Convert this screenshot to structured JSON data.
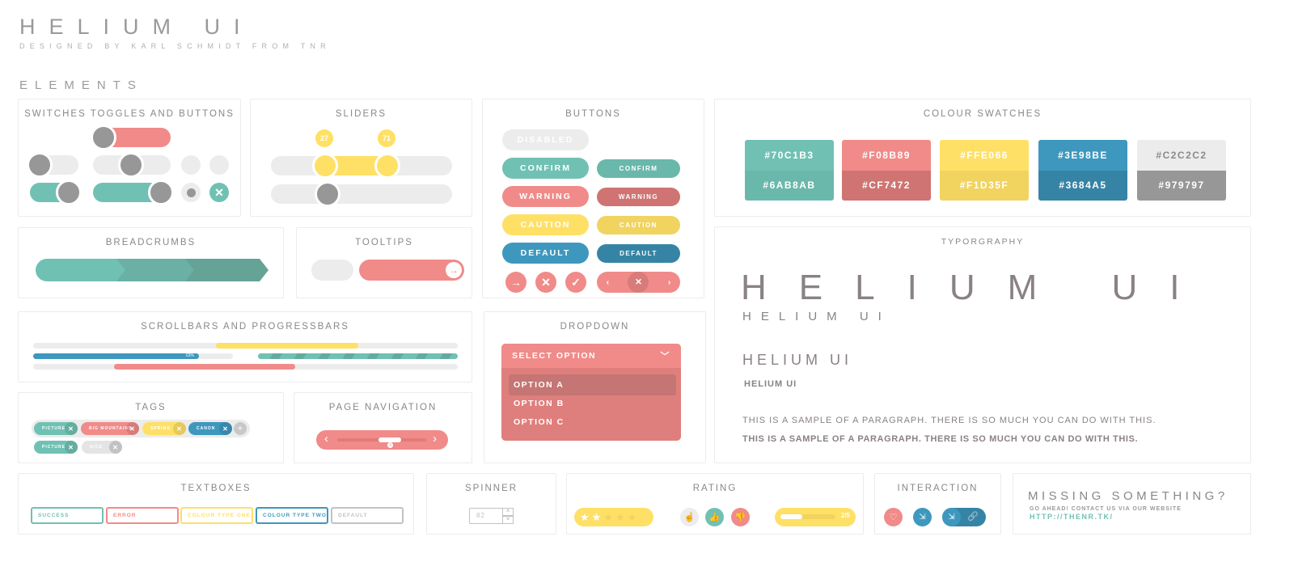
{
  "header": {
    "title": "HELIUM UI",
    "subtitle": "DESIGNED BY KARL SCHMIDT FROM TNR",
    "section": "ELEMENTS"
  },
  "cards": {
    "switches": "SWITCHES TOGGLES AND BUTTONS",
    "sliders": "SLIDERS",
    "buttons": "BUTTONS",
    "swatches": "COLOUR SWATCHES",
    "breadcrumbs": "BREADCRUMBS",
    "tooltips": "TOOLTIPS",
    "typography": "TYPORGRAPHY",
    "scrollbars": "SCROLLBARS AND PROGRESSBARS",
    "dropdown": "DROPDOWN",
    "tags": "TAGS",
    "page_navigation": "PAGE NAVIGATION",
    "textboxes": "TEXTBOXES",
    "spinner": "SPINNER",
    "rating": "RATING",
    "interaction": "INTERACTION"
  },
  "switches": {
    "toggle_states": [
      "off",
      "off",
      "middle",
      "on",
      "on"
    ],
    "radio_states": [
      "empty",
      "empty",
      "selected",
      "checked"
    ]
  },
  "sliders": {
    "range": {
      "low": 27,
      "high": 71,
      "low_label": "27",
      "high_label": "71"
    },
    "single": {
      "value": 31
    }
  },
  "buttons": {
    "disabled": "DISABLED",
    "confirm": "CONFIRM",
    "warning": "WARNING",
    "caution": "CAUTION",
    "default": "DEFAULT",
    "icons": [
      "arrow-right",
      "close",
      "check"
    ],
    "group_icons": [
      "chevron-left",
      "close",
      "chevron-right"
    ]
  },
  "swatches": [
    {
      "name": "teal",
      "light": "#70C1B3",
      "dark": "#6AB8AB"
    },
    {
      "name": "red",
      "light": "#F08B89",
      "dark": "#CF7472"
    },
    {
      "name": "yellow",
      "light": "#FFE066",
      "dark": "#F1D35F"
    },
    {
      "name": "blue",
      "light": "#3E98BE",
      "dark": "#3684A5"
    },
    {
      "name": "gray",
      "light": "#C2C2C2",
      "dark": "#979797"
    }
  ],
  "scrollbars": {
    "progress_label": "63%",
    "progress_value": 0.63
  },
  "dropdown": {
    "placeholder": "SELECT OPTION",
    "options": [
      "OPTION A",
      "OPTION B",
      "OPTION C"
    ],
    "highlighted": "OPTION A"
  },
  "tags": {
    "row1": [
      "PICTURE",
      "BIG MOUNTAINS",
      "SPRING",
      "CANON"
    ],
    "row2": [
      "PICTURE",
      "NICE"
    ]
  },
  "page_navigation": {
    "current_page": "3"
  },
  "typography": {
    "h1": "HELIUM UI",
    "h2": "HELIUM UI",
    "h3": "HELIUM UI",
    "h4": "HELIUM UI",
    "p1": "THIS IS A SAMPLE OF A PARAGRAPH. THERE IS SO MUCH YOU CAN DO WITH THIS.",
    "p2": "THIS IS A SAMPLE OF A PARAGRAPH. THERE IS SO MUCH YOU CAN DO WITH THIS."
  },
  "textboxes": {
    "success": "SUCCESS",
    "error": "ERROR",
    "colour_one": "COLOUR TYPE ONE",
    "colour_two": "COLOUR TYPE TWO",
    "default": "DEFAULT"
  },
  "spinner": {
    "value": "82"
  },
  "rating": {
    "stars_filled": 2,
    "stars_total": 5,
    "progress_label": "2/5",
    "progress_value": 0.4
  },
  "missing": {
    "title": "MISSING SOMETHING?",
    "subtitle": "GO AHEAD! CONTACT US VIA OUR WEBSITE",
    "link": "HTTP://THENR.TK/"
  },
  "colors": {
    "teal": "#70C1B3",
    "red": "#F08B89",
    "yellow": "#FFE066",
    "blue": "#3E98BE",
    "gray": "#C2C2C2"
  }
}
